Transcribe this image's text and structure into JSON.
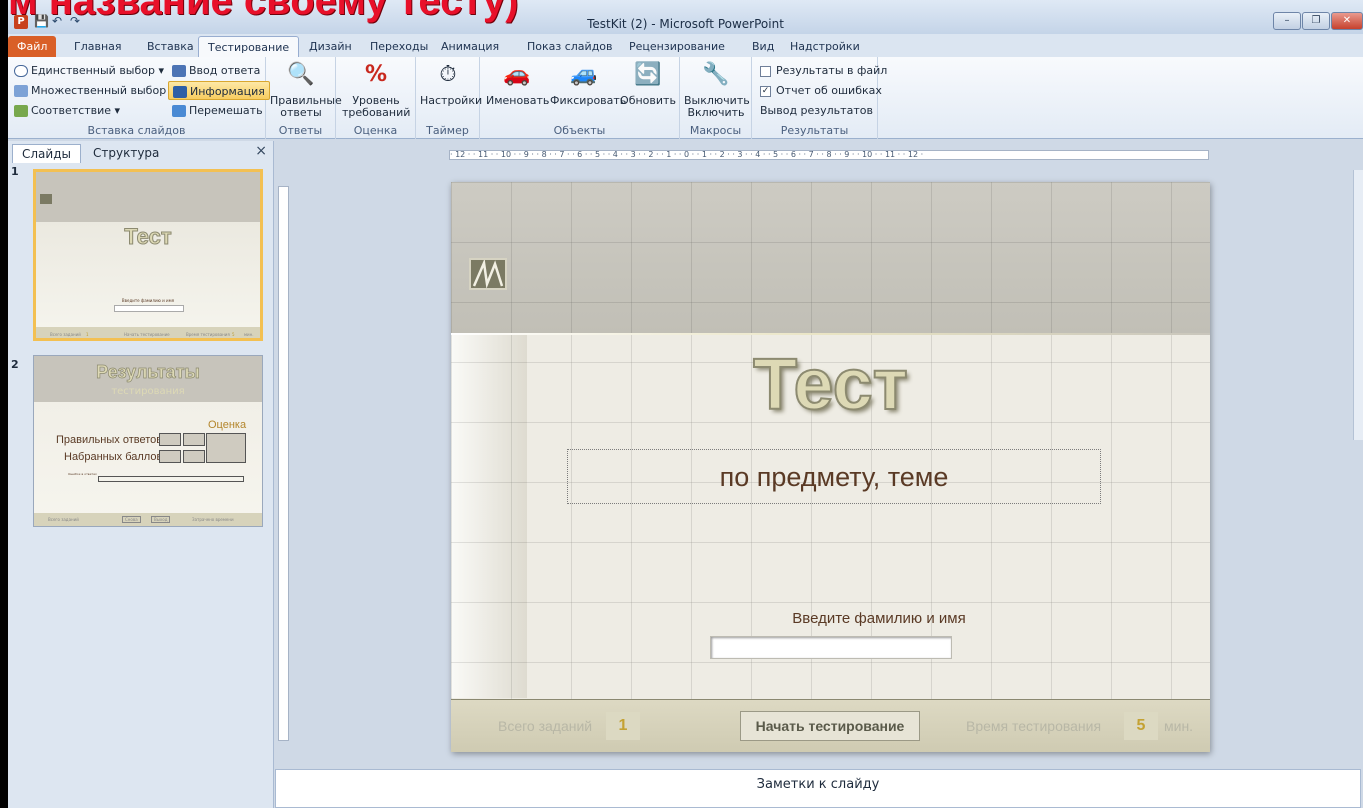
{
  "overlay_caption": "м название своему тесту)",
  "window": {
    "title": "TestKit (2) - Microsoft PowerPoint",
    "app_icon": "P",
    "minimize": "–",
    "maximize": "❐",
    "close": "✕"
  },
  "quick_access": {
    "save": "💾",
    "undo": "↶",
    "redo": "↷"
  },
  "tabs": [
    "Файл",
    "Главная",
    "Вставка",
    "Тестирование",
    "Дизайн",
    "Переходы",
    "Анимация",
    "Показ слайдов",
    "Рецензирование",
    "Вид",
    "Надстройки"
  ],
  "ribbon": {
    "insert": {
      "single": "Единственный выбор",
      "multiple": "Множественный выбор",
      "match": "Соответствие",
      "input_answer": "Ввод ответа",
      "info": "Информация",
      "shuffle": "Перемешать",
      "group": "Вставка слайдов"
    },
    "answers": {
      "label1": "Правильные",
      "label2": "ответы",
      "group": "Ответы"
    },
    "rating": {
      "label1": "Уровень",
      "label2": "требований",
      "group": "Оценка"
    },
    "timer": {
      "label": "Настройки",
      "group": "Таймер"
    },
    "objects": {
      "rename": "Именовать",
      "fix": "Фиксировать",
      "update": "Обновить",
      "group": "Объекты"
    },
    "macros": {
      "label1": "Выключить",
      "label2": "Включить",
      "group": "Макросы"
    },
    "results": {
      "to_file": "Результаты в файл",
      "error_report": "Отчет об ошибках",
      "output": "Вывод результатов",
      "group": "Результаты"
    }
  },
  "pane": {
    "tab_slides": "Слайды",
    "tab_structure": "Структура",
    "close": "×",
    "slide1": {
      "num": "1",
      "title": "Тест",
      "field": "Введите фамилию и имя",
      "b1": "Всего заданий",
      "b1v": "1",
      "b2": "Начать тестирование",
      "b3": "Время тестирования",
      "b3v": "5",
      "b3u": "мин."
    },
    "slide2": {
      "num": "2",
      "title": "Результаты",
      "subtitle": "тестирования",
      "rating": "Оценка",
      "correct": "Правильных ответов",
      "points": "Набранных баллов",
      "note": "Ошибок в ответах",
      "b1": "Всего заданий",
      "b2": "Снова",
      "b3": "Выход",
      "b4": "Затрачено времени"
    }
  },
  "ruler_h": "· 12 · · 11 · · 10 · · 9 · · 8 · · 7 · · 6 · · 5 · · 4 · · 3 · · 2 · · 1 · · 0 · · 1 · · 2 · · 3 · · 4 · · 5 · · 6 · · 7 · · 8 · · 9 · · 10 · · 11 · · 12 ·",
  "slide": {
    "title": "Тест",
    "subtitle": "по предмету, теме",
    "name_label": "Введите фамилию и имя",
    "total_label": "Всего заданий",
    "total_value": "1",
    "start_button": "Начать тестирование",
    "time_label": "Время тестирования",
    "time_value": "5",
    "time_unit": "мин."
  },
  "notes": "Заметки к слайду"
}
